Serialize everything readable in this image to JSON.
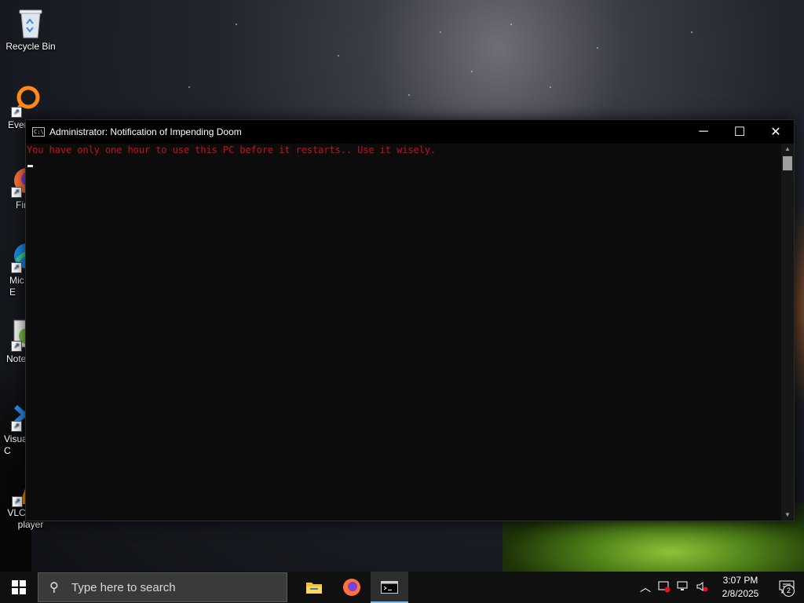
{
  "desktop": {
    "icons": [
      {
        "label": "Recycle Bin",
        "icon": "recycle-bin-icon"
      },
      {
        "label": "Ever",
        "icon": "everything-search-icon"
      },
      {
        "label": "Fir",
        "icon": "firefox-icon"
      },
      {
        "label": "Mic\nE",
        "icon": "edge-icon"
      },
      {
        "label": "Note",
        "icon": "notepad-plus-plus-icon"
      },
      {
        "label": "Visua\nC",
        "icon": "vscode-icon"
      },
      {
        "label": "VLC media\nplayer",
        "icon": "vlc-icon"
      }
    ]
  },
  "console": {
    "title": "Administrator:  Notification of Impending Doom",
    "message": "You have only one hour to use this PC before it restarts.. Use it wisely.",
    "text_color": "#c50f1f",
    "background": "#0c0c0c",
    "buttons": {
      "minimize": "─",
      "maximize": "☐",
      "close": "✕"
    }
  },
  "taskbar": {
    "search_placeholder": "Type here to search",
    "apps": [
      {
        "name": "file-explorer-icon"
      },
      {
        "name": "firefox-icon"
      },
      {
        "name": "command-prompt-icon",
        "active": true
      }
    ],
    "clock": {
      "time": "3:07 PM",
      "date": "2/8/2025"
    },
    "notification_count": "2",
    "accent": "#76b9ed"
  }
}
